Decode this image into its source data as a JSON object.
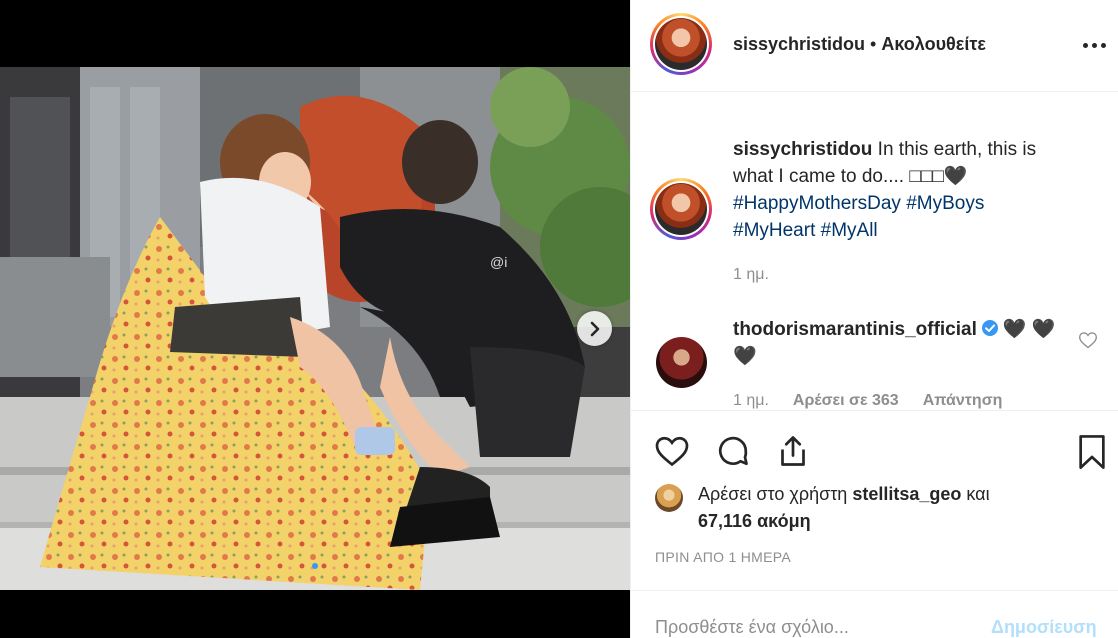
{
  "post": {
    "author": "sissychristidou",
    "follow_separator": " • ",
    "follow_status": "Ακολουθείτε",
    "caption_text": "In this earth, this is what I came to do.... ",
    "caption_emoji": "□□□🖤",
    "hashtags": [
      "#HappyMothersDay",
      "#MyBoys",
      "#MyHeart",
      "#MyAll"
    ],
    "caption_time": "1 ημ."
  },
  "comment": {
    "user": "thodorismarantinis_official",
    "text": "🖤 🖤🖤",
    "time": "1 ημ.",
    "likes": "Αρέσει σε 363",
    "reply": "Απάντηση"
  },
  "likes": {
    "prefix": "Αρέσει στο χρήστη",
    "user": "stellitsa_geo",
    "conjunction": "και",
    "count_text": "67,116 ακόμη"
  },
  "timestamp": "ΠΡΙΝ ΑΠΟ 1 ΗΜΕΡΑ",
  "add_comment": {
    "placeholder": "Προσθέστε ένα σχόλιο...",
    "post_button": "Δημοσίευση"
  },
  "colors": {
    "hashtag": "#003569",
    "verified": "#3897f0",
    "post_button_disabled": "#b2dffc",
    "muted": "#8e8e8e"
  },
  "icons": [
    "chevron-right-icon",
    "more-icon",
    "verified-icon",
    "heart-icon",
    "comment-icon",
    "share-icon",
    "bookmark-icon"
  ]
}
